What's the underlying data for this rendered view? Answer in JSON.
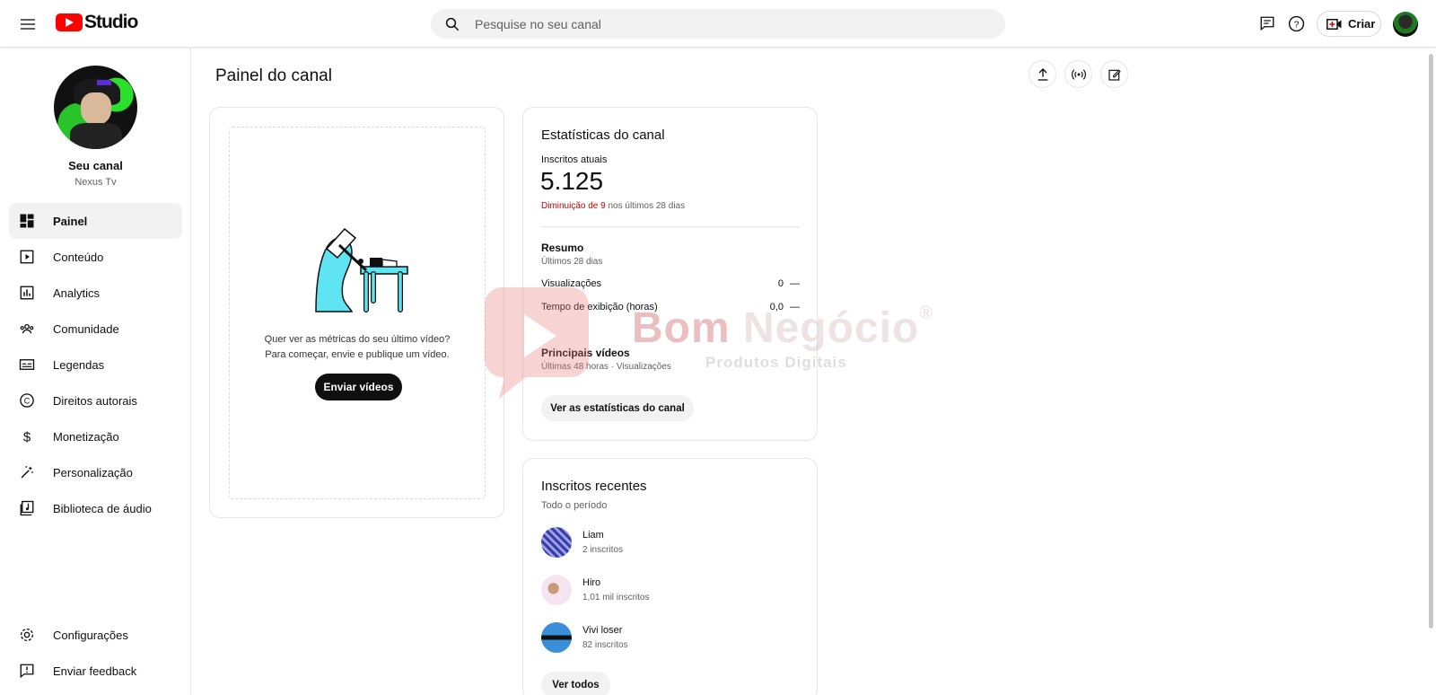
{
  "header": {
    "logo_text": "Studio",
    "search_placeholder": "Pesquise no seu canal",
    "create_label": "Criar"
  },
  "sidebar": {
    "channel_title": "Seu canal",
    "channel_name": "Nexus Tv",
    "items": [
      {
        "label": "Painel",
        "icon": "dashboard-icon",
        "active": true
      },
      {
        "label": "Conteúdo",
        "icon": "content-icon"
      },
      {
        "label": "Analytics",
        "icon": "analytics-icon"
      },
      {
        "label": "Comunidade",
        "icon": "community-icon"
      },
      {
        "label": "Legendas",
        "icon": "subtitles-icon"
      },
      {
        "label": "Direitos autorais",
        "icon": "copyright-icon"
      },
      {
        "label": "Monetização",
        "icon": "monetization-icon"
      },
      {
        "label": "Personalização",
        "icon": "magic-wand-icon"
      },
      {
        "label": "Biblioteca de áudio",
        "icon": "audio-library-icon"
      }
    ],
    "bottom_items": [
      {
        "label": "Configurações",
        "icon": "gear-icon"
      },
      {
        "label": "Enviar feedback",
        "icon": "feedback-icon"
      }
    ]
  },
  "main": {
    "page_title": "Painel do canal",
    "upload_card": {
      "line1": "Quer ver as métricas do seu último vídeo?",
      "line2": "Para começar, envie e publique um vídeo.",
      "button": "Enviar vídeos"
    },
    "stats_card": {
      "title": "Estatísticas do canal",
      "subs_label": "Inscritos atuais",
      "subs_count": "5.125",
      "delta_negative": "Diminuição de 9",
      "delta_rest": " nos últimos 28 dias",
      "summary_title": "Resumo",
      "summary_period": "Últimos 28 dias",
      "metrics": [
        {
          "label": "Visualizações",
          "value": "0",
          "trend": "—"
        },
        {
          "label": "Tempo de exibição (horas)",
          "value": "0,0",
          "trend": "—"
        }
      ],
      "top_videos_title": "Principais vídeos",
      "top_videos_period": "Últimas 48 horas · Visualizações",
      "button": "Ver as estatísticas do canal"
    },
    "recent_card": {
      "title": "Inscritos recentes",
      "period": "Todo o período",
      "subscribers": [
        {
          "name": "Liam",
          "count": "2 inscritos",
          "color": "#5a5fc4"
        },
        {
          "name": "Hiro",
          "count": "1,01 mil inscritos",
          "color": "#f2d6ee"
        },
        {
          "name": "Vivi loser",
          "count": "82 inscritos",
          "color": "#3b8ed8"
        }
      ],
      "button": "Ver todos"
    }
  },
  "watermark": {
    "title_part1": "Bom",
    "title_part2": " Negócio",
    "registered": "®",
    "subtitle": "Produtos Digitais"
  }
}
